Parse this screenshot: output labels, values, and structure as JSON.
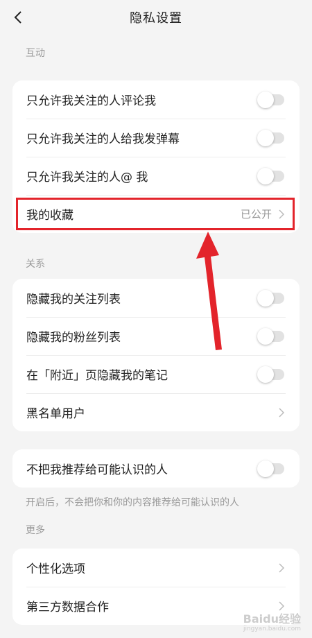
{
  "header": {
    "title": "隐私设置",
    "back_icon": "back-chevron-icon"
  },
  "sections": {
    "interaction": {
      "label": "互动",
      "items": [
        {
          "label": "只允许我关注的人评论我",
          "toggle": false
        },
        {
          "label": "只允许我关注的人给我发弹幕",
          "toggle": false
        },
        {
          "label": "只允许我关注的人@ 我",
          "toggle": false
        },
        {
          "label": "我的收藏",
          "value": "已公开"
        }
      ]
    },
    "relations": {
      "label": "关系",
      "items": [
        {
          "label": "隐藏我的关注列表",
          "toggle": false
        },
        {
          "label": "隐藏我的粉丝列表",
          "toggle": false
        },
        {
          "label": "在「附近」页隐藏我的笔记",
          "toggle": false
        },
        {
          "label": "黑名单用户"
        }
      ]
    },
    "recommend": {
      "items": [
        {
          "label": "不把我推荐给可能认识的人",
          "toggle": false
        }
      ],
      "note": "开启后，不会把你和你的内容推荐给可能认识的人"
    },
    "more": {
      "label": "更多",
      "items": [
        {
          "label": "个性化选项"
        },
        {
          "label": "第三方数据合作"
        }
      ]
    }
  },
  "annotation": {
    "highlight_color": "#e3242b"
  },
  "watermark": {
    "main": "Baidu经验",
    "sub": "jingyan.baidu.com"
  }
}
